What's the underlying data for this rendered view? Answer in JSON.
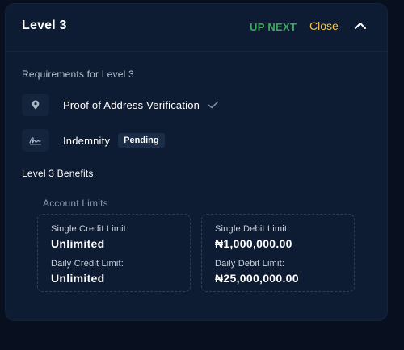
{
  "header": {
    "title": "Level 3",
    "status": "UP NEXT",
    "close_label": "Close"
  },
  "requirements": {
    "title": "Requirements for Level 3",
    "items": [
      {
        "label": "Proof of Address Verification",
        "icon": "location-pin-icon",
        "status": "verified"
      },
      {
        "label": "Indemnity",
        "icon": "signature-icon",
        "badge": "Pending"
      }
    ]
  },
  "benefits": {
    "title": "Level 3 Benefits",
    "limits_title": "Account Limits",
    "credit": {
      "single_label": "Single Credit Limit:",
      "single_value": "Unlimited",
      "daily_label": "Daily Credit Limit:",
      "daily_value": "Unlimited"
    },
    "debit": {
      "single_label": "Single Debit Limit:",
      "single_value": "₦1,000,000.00",
      "daily_label": "Daily Debit Limit:",
      "daily_value": "₦25,000,000.00"
    }
  },
  "colors": {
    "background": "#08101f",
    "card": "#0e1c33",
    "up_next": "#3bab5a",
    "close": "#f2c14e"
  }
}
